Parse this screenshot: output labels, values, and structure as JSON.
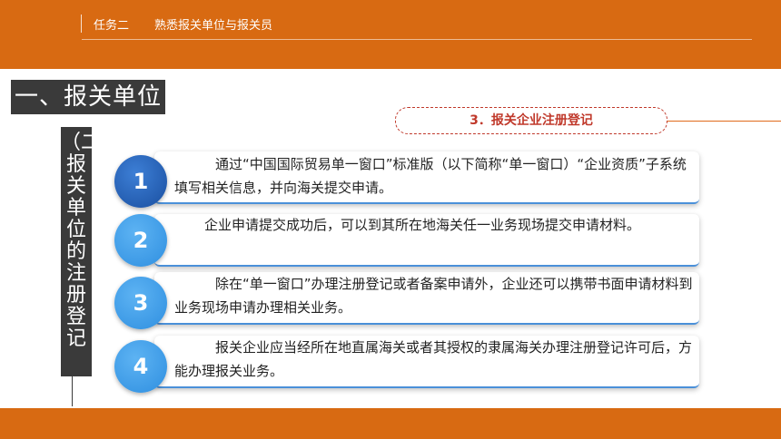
{
  "header": {
    "task_label": "任务二",
    "topic_label": "熟悉报关单位与报关员"
  },
  "section": {
    "heading": "一、报关单位",
    "vertical_title": "（二）报关单位的注册登记"
  },
  "subsection": {
    "title": "3．报关企业注册登记"
  },
  "steps": [
    {
      "number": "1",
      "text": "通过“中国国际贸易单一窗口”标准版（以下简称“单一窗口）“企业资质”子系统填写相关信息，并向海关提交申请。"
    },
    {
      "number": "2",
      "text": "企业申请提交成功后，可以到其所在地海关任一业务现场提交申请材料。"
    },
    {
      "number": "3",
      "text": "除在“单一窗口”办理注册登记或者备案申请外，企业还可以携带书面申请材料到业务现场申请办理相关业务。"
    },
    {
      "number": "4",
      "text": "报关企业应当经所在地直属海关或者其授权的隶属海关办理注册登记许可后，方能办理报关业务。"
    }
  ],
  "colors": {
    "brand_orange": "#d86a12",
    "heading_dark": "#3a3a3a",
    "accent_red": "#c0392b",
    "bubble_blue": "#2f8fe0"
  }
}
